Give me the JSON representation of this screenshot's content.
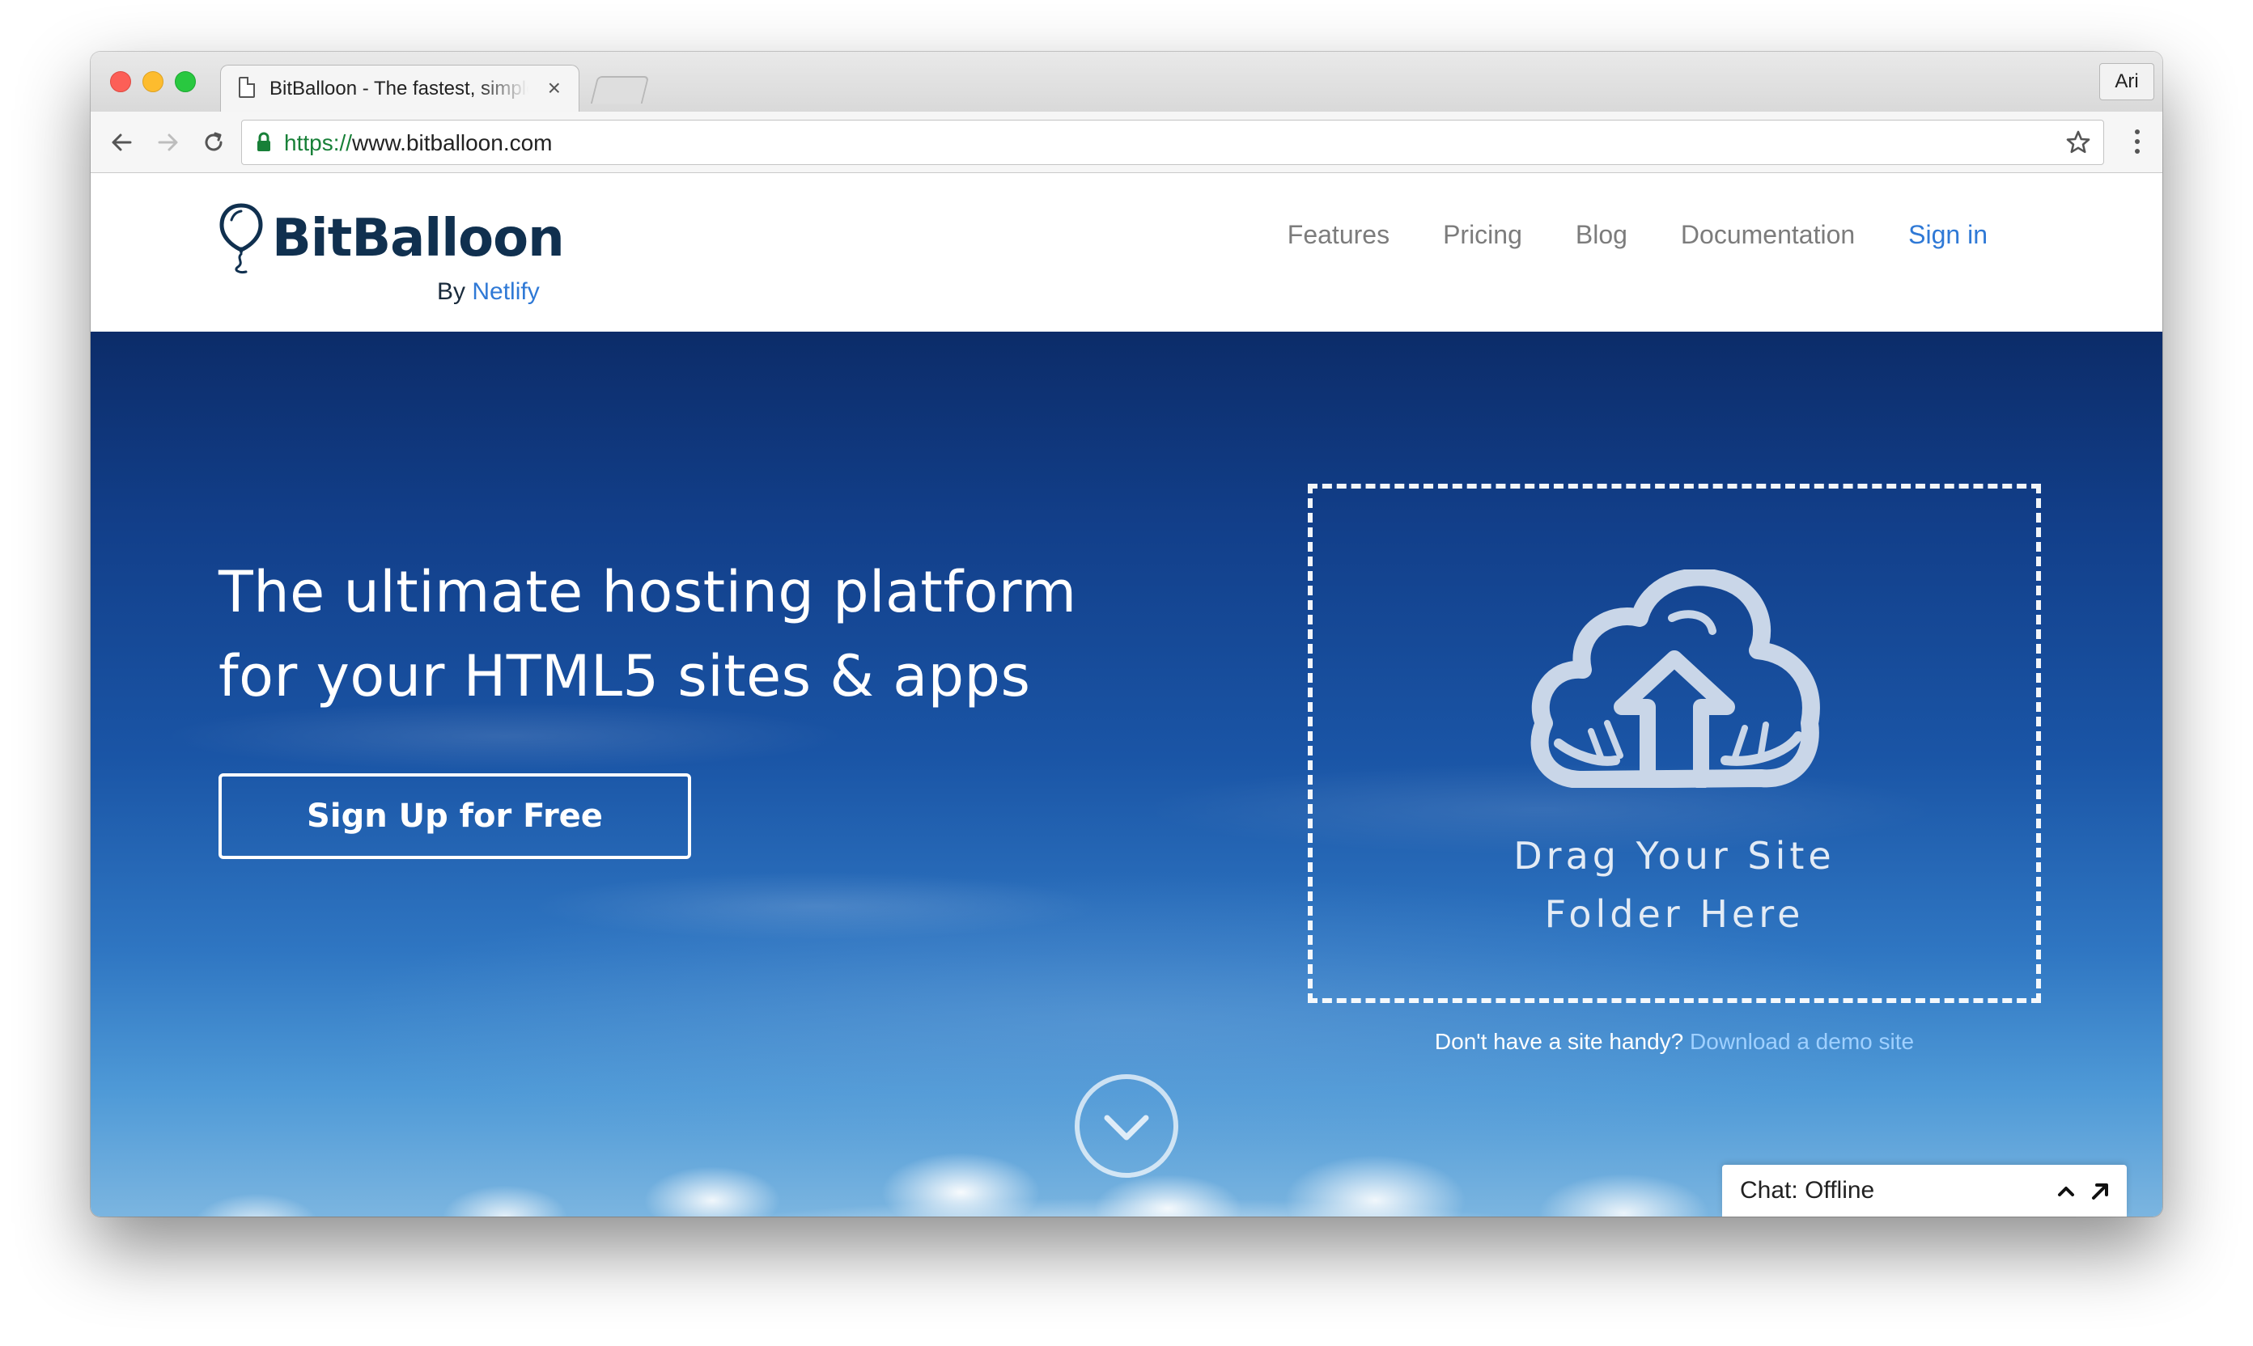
{
  "browser": {
    "tab_title": "BitBalloon - The fastest, simplest way to host",
    "tab_close": "×",
    "profile_name": "Ari",
    "url_scheme": "https://",
    "url_rest": "www.bitballoon.com"
  },
  "site": {
    "logo_text": "BitBalloon",
    "by_label": "By",
    "by_link": "Netlify",
    "nav": {
      "features": "Features",
      "pricing": "Pricing",
      "blog": "Blog",
      "documentation": "Documentation",
      "signin": "Sign in"
    }
  },
  "hero": {
    "headline_line1": "The ultimate hosting platform",
    "headline_line2": "for your HTML5 sites & apps",
    "signup_button": "Sign Up for Free",
    "drop_line1": "Drag Your Site",
    "drop_line2": "Folder Here",
    "demo_prefix": "Don't have a site handy?",
    "demo_link": "Download a demo site"
  },
  "chat": {
    "label": "Chat:",
    "status": "Offline"
  },
  "colors": {
    "brand_navy": "#10304f",
    "link_blue": "#2f79d6",
    "sky_top": "#0c2c69",
    "sky_bottom": "#7bb5e0"
  },
  "icons": [
    "page-icon",
    "back-arrow-icon",
    "forward-arrow-icon",
    "reload-icon",
    "lock-icon",
    "star-icon",
    "menu-dots-icon",
    "balloon-logo-icon",
    "cloud-upload-icon",
    "chevron-down-circle-icon",
    "chevron-up-icon",
    "popout-arrow-icon"
  ]
}
